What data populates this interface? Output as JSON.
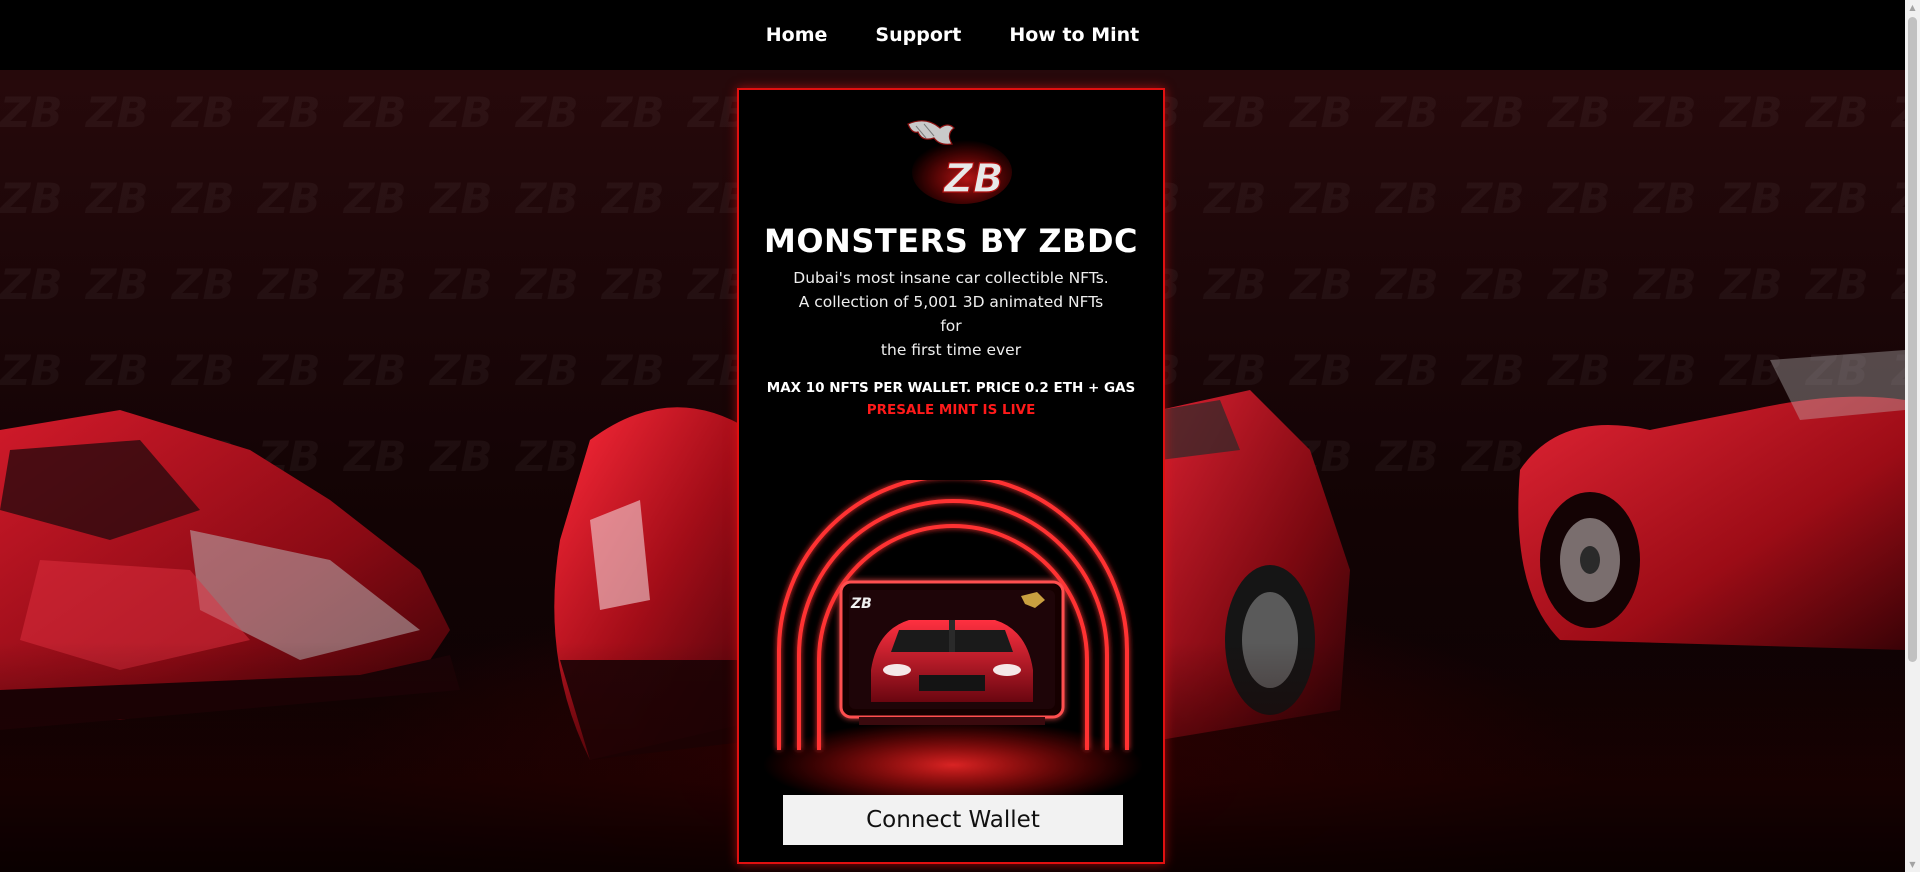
{
  "nav": {
    "items": [
      {
        "label": "Home"
      },
      {
        "label": "Support"
      },
      {
        "label": "How to Mint"
      }
    ]
  },
  "background": {
    "pattern_text": "ZB"
  },
  "card": {
    "logo_text": "ZB",
    "title": "MONSTERS BY ZBDC",
    "description_line1": "Dubai's most insane car collectible NFTs.",
    "description_line2": "A collection of 5,001 3D animated NFTs for",
    "description_line3": "the first time ever",
    "max_text": "MAX 10 NFTS PER WALLET. PRICE 0.2 ETH + GAS",
    "presale_text": "PRESALE MINT IS LIVE",
    "showcase_badge": "ZB",
    "connect_label": "Connect Wallet"
  },
  "colors": {
    "accent": "#e01010",
    "presale": "#ff1a1a",
    "button_bg": "#f2f2f2",
    "nav_bg": "#000000"
  }
}
